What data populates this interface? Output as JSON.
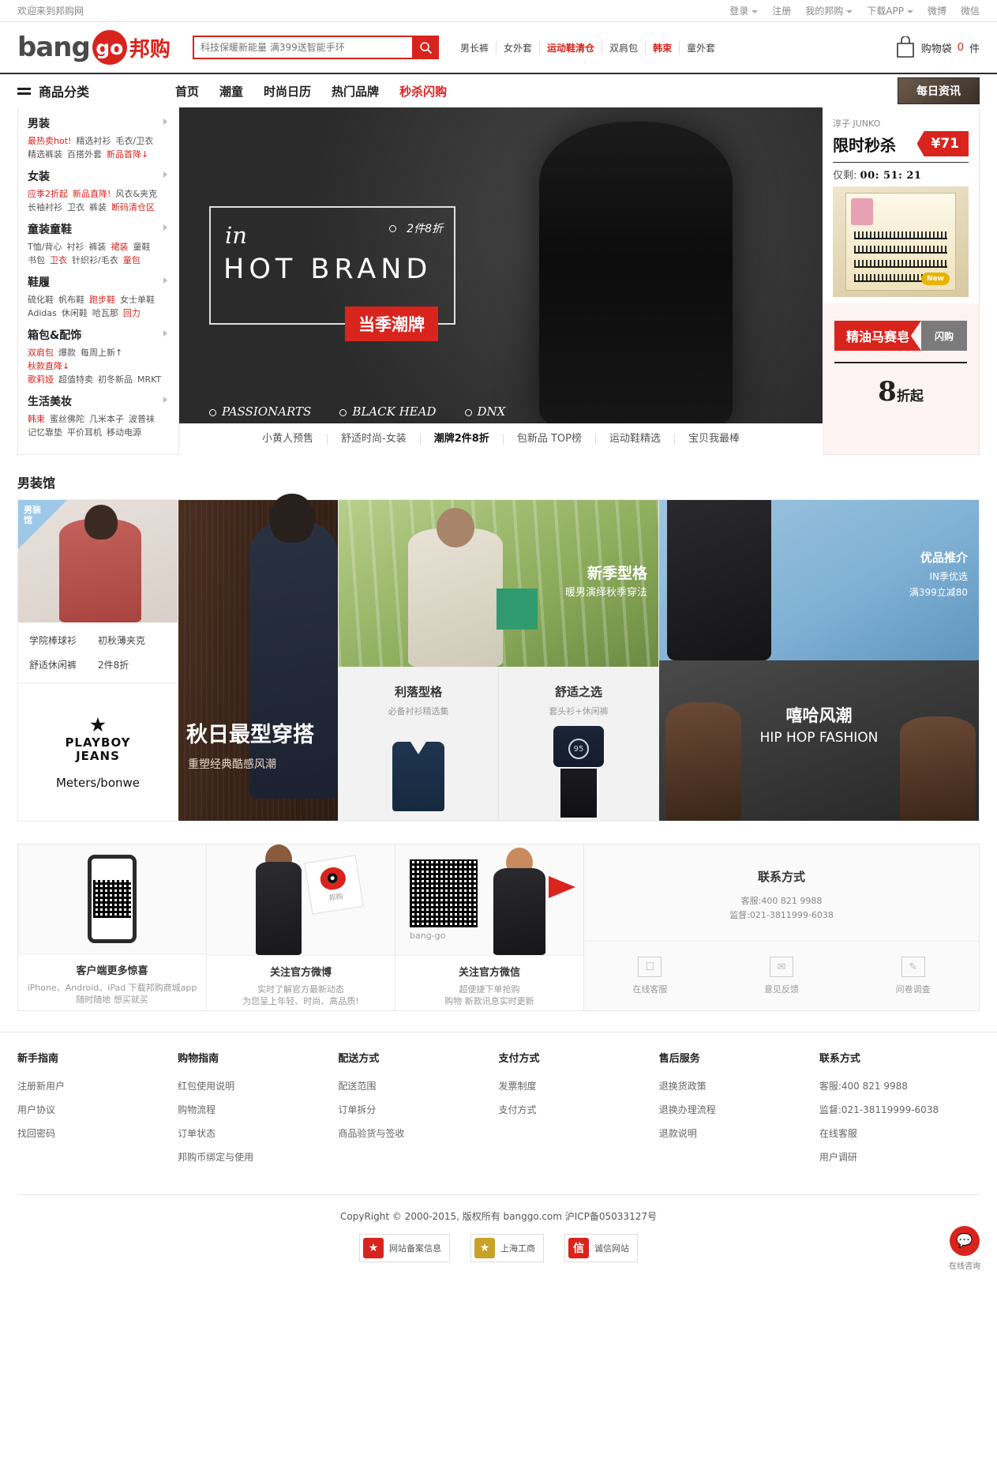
{
  "topbar": {
    "welcome": "欢迎来到邦购网",
    "links": [
      {
        "label": "登录",
        "caret": true
      },
      {
        "label": "注册",
        "caret": false
      },
      {
        "label": "我的邦购",
        "caret": true
      },
      {
        "label": "下载APP",
        "caret": true
      },
      {
        "label": "微博",
        "caret": false
      },
      {
        "label": "微信",
        "caret": false
      }
    ]
  },
  "header": {
    "logo": {
      "bang": "bang",
      "go": "go",
      "cn": "邦购"
    },
    "search": {
      "value": "科技保暖新能量 满399送智能手环",
      "placeholder": "科技保暖新能量 满399送智能手环",
      "icon": "search-icon"
    },
    "hotwords": [
      {
        "label": "男长裤",
        "red": false
      },
      {
        "label": "女外套",
        "red": false
      },
      {
        "label": "运动鞋清仓",
        "red": true
      },
      {
        "label": "双肩包",
        "red": false
      },
      {
        "label": "韩束",
        "red": true
      },
      {
        "label": "童外套",
        "red": false
      }
    ],
    "cart": {
      "icon": "cart-icon",
      "label": "购物袋",
      "count": "0",
      "unit": "件"
    }
  },
  "nav": {
    "category_label": "商品分类",
    "items": [
      {
        "label": "首页",
        "red": false
      },
      {
        "label": "潮童",
        "red": false
      },
      {
        "label": "时尚日历",
        "red": false
      },
      {
        "label": "热门品牌",
        "red": false
      },
      {
        "label": "秒杀闪购",
        "red": true
      }
    ],
    "news_badge": "每日资讯"
  },
  "sidebar": {
    "groups": [
      {
        "title": "男装",
        "links": [
          {
            "label": "最热卖hot!",
            "red": true
          },
          {
            "label": "精选衬衫",
            "red": false
          },
          {
            "label": "毛衣/卫衣",
            "red": false
          },
          {
            "label": "精选裤装",
            "red": false
          },
          {
            "label": "百搭外套",
            "red": false
          },
          {
            "label": "新品首降↓",
            "red": true
          }
        ]
      },
      {
        "title": "女装",
        "links": [
          {
            "label": "应季2折起",
            "red": true
          },
          {
            "label": "新品直降!",
            "red": true
          },
          {
            "label": "风衣&夹克",
            "red": false
          },
          {
            "label": "长袖衬衫",
            "red": false
          },
          {
            "label": "卫衣",
            "red": false
          },
          {
            "label": "裤装",
            "red": false
          },
          {
            "label": "断码清仓区",
            "red": true
          }
        ]
      },
      {
        "title": "童装童鞋",
        "links": [
          {
            "label": "T恤/背心",
            "red": false
          },
          {
            "label": "衬衫",
            "red": false
          },
          {
            "label": "裤装",
            "red": false
          },
          {
            "label": "裙装",
            "red": true
          },
          {
            "label": "童鞋",
            "red": false
          },
          {
            "label": "书包",
            "red": false
          },
          {
            "label": "卫衣",
            "red": true
          },
          {
            "label": "针织衫/毛衣",
            "red": false
          },
          {
            "label": "童包",
            "red": true
          }
        ]
      },
      {
        "title": "鞋履",
        "links": [
          {
            "label": "硫化鞋",
            "red": false
          },
          {
            "label": "帆布鞋",
            "red": false
          },
          {
            "label": "跑步鞋",
            "red": true
          },
          {
            "label": "女士单鞋",
            "red": false
          },
          {
            "label": "Adidas",
            "red": false
          },
          {
            "label": "休闲鞋",
            "red": false
          },
          {
            "label": "哈瓦那",
            "red": false
          },
          {
            "label": "回力",
            "red": true
          }
        ]
      },
      {
        "title": "箱包&配饰",
        "links": [
          {
            "label": "双肩包",
            "red": true
          },
          {
            "label": "爆款",
            "red": false
          },
          {
            "label": "每周上新↑",
            "red": false
          },
          {
            "label": "秋款直降↓",
            "red": true
          },
          {
            "label": "歌莉娅",
            "red": true
          },
          {
            "label": "超值特卖",
            "red": false
          },
          {
            "label": "初冬新品",
            "red": false
          },
          {
            "label": "MRKT",
            "red": false
          }
        ]
      },
      {
        "title": "生活美妆",
        "links": [
          {
            "label": "韩束",
            "red": true
          },
          {
            "label": "蜜丝佛陀",
            "red": false
          },
          {
            "label": "几米本子",
            "red": false
          },
          {
            "label": "波普袜",
            "red": false
          },
          {
            "label": "记忆靠垫",
            "red": false
          },
          {
            "label": "平价耳机",
            "red": false
          },
          {
            "label": "移动电源",
            "red": false
          }
        ]
      }
    ]
  },
  "carousel": {
    "in_text": "in",
    "brand_text": "HOT BRAND",
    "discount_text": "2件8折",
    "ribbon": "当季潮牌",
    "brands": [
      "PASSIONARTS",
      "BLACK HEAD",
      "DNX"
    ],
    "tabs": [
      {
        "label": "小黄人预售",
        "active": false
      },
      {
        "label": "舒适时尚-女装",
        "active": false
      },
      {
        "label": "潮牌2件8折",
        "active": true
      },
      {
        "label": "包新品 TOP榜",
        "active": false
      },
      {
        "label": "运动鞋精选",
        "active": false
      },
      {
        "label": "宝贝我最棒",
        "active": false
      }
    ]
  },
  "promo": {
    "flash": {
      "brand": "淳子 JUNKO",
      "title": "限时秒杀",
      "price": "¥71",
      "timer_label": "仅剩:",
      "timer_value": "00: 51: 21",
      "product_badge": "New"
    },
    "soap": {
      "name": "精油马赛皂",
      "tag": "闪购",
      "discount_number": "8",
      "discount_suffix": "折起"
    }
  },
  "men_section": {
    "title": "男装馆",
    "col1": {
      "corner_label": "男装馆",
      "links": [
        [
          "学院棒球衫",
          "初秋薄夹克"
        ],
        [
          "舒适休闲裤",
          "2件8折"
        ]
      ],
      "brands": {
        "playboy_icon": "playboy-bunny-icon",
        "playboy_line1": "PLAYBOY",
        "playboy_line2": "JEANS",
        "meters": "Meters/bonwe"
      }
    },
    "col2": {
      "title": "秋日最型穿搭",
      "subtitle": "重塑经典酷感风潮"
    },
    "col3": {
      "forest_title": "新季型格",
      "forest_sub": "暖男演绎秋季穿法",
      "tiles": [
        {
          "title": "利落型格",
          "sub": "必备衬衫精选集"
        },
        {
          "title": "舒适之选",
          "sub": "套头衫+休闲裤"
        }
      ]
    },
    "col4": {
      "jacket_title": "优品推介",
      "jacket_line1": "IN季优选",
      "jacket_line2": "满399立减80",
      "hip_title": "嘻哈风潮",
      "hip_sub": "HIP HOP FASHION"
    }
  },
  "qr_panels": [
    {
      "icon": "app-qrcode-icon",
      "title": "客户端更多惊喜",
      "sub1": "iPhone、Android、iPad 下载邦购商城app",
      "sub2": "随时随地 想买就买"
    },
    {
      "icon": "weibo-icon",
      "card_label": "邦购",
      "title": "关注官方微博",
      "sub1": "实时了解官方最新动态",
      "sub2": "为您呈上年轻、时尚、高品质!"
    },
    {
      "icon": "wechat-qrcode-icon",
      "card_label": "bang-go",
      "title": "关注官方微信",
      "sub1": "超便捷下单抢购",
      "sub2": "购物 新款讯息实时更新"
    }
  ],
  "contact_panel": {
    "title": "联系方式",
    "line1": "客服:400 821 9988",
    "line2": "监督:021-3811999-6038",
    "buttons": [
      {
        "icon": "chat-icon",
        "label": "在线客服"
      },
      {
        "icon": "mail-icon",
        "label": "意见反馈"
      },
      {
        "icon": "survey-icon",
        "label": "问卷调查"
      }
    ]
  },
  "footer": {
    "columns": [
      {
        "heading": "新手指南",
        "links": [
          "注册新用户",
          "用户协议",
          "找回密码"
        ]
      },
      {
        "heading": "购物指南",
        "links": [
          "红包使用说明",
          "购物流程",
          "订单状态",
          "邦购币绑定与使用"
        ]
      },
      {
        "heading": "配送方式",
        "links": [
          "配送范围",
          "订单拆分",
          "商品验货与签收"
        ]
      },
      {
        "heading": "支付方式",
        "links": [
          "发票制度",
          "支付方式"
        ]
      },
      {
        "heading": "售后服务",
        "links": [
          "退换货政策",
          "退换办理流程",
          "退款说明"
        ]
      },
      {
        "heading": "联系方式",
        "links": [
          "客服:400 821 9988",
          "监督:021-38119999-6038",
          "在线客服",
          "用户调研"
        ]
      }
    ],
    "copyright": "CopyRight © 2000-2015, 版权所有 banggo.com 沪ICP备05033127号",
    "certs": [
      {
        "icon": "police-badge-icon",
        "label": "网站备案信息",
        "gold": false
      },
      {
        "icon": "shanghai-gs-icon",
        "label": "上海工商",
        "gold": true
      },
      {
        "icon": "credit-icon",
        "label": "诚信网站",
        "gold": false
      }
    ],
    "float_chat": {
      "icon": "chat-bubble-icon",
      "label": "在线咨询"
    }
  }
}
